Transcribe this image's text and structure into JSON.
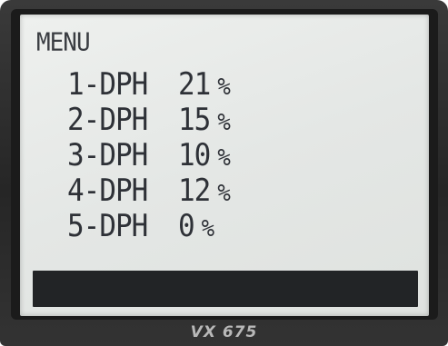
{
  "screen": {
    "title": "MENU",
    "items": [
      {
        "label": "1-DPH",
        "value": "21",
        "unit": "%"
      },
      {
        "label": "2-DPH",
        "value": "15",
        "unit": "%"
      },
      {
        "label": "3-DPH",
        "value": "10",
        "unit": "%"
      },
      {
        "label": "4-DPH",
        "value": "12",
        "unit": "%"
      },
      {
        "label": "5-DPH",
        "value": "0",
        "unit": "%"
      }
    ]
  },
  "device": {
    "model": "VX 675"
  },
  "colors": {
    "lcd_background": "#e6e9e7",
    "lcd_text": "#2e3137",
    "status_bar": "#222426",
    "bezel": "#1b1b1b",
    "brand_text": "#b8b8b8"
  }
}
